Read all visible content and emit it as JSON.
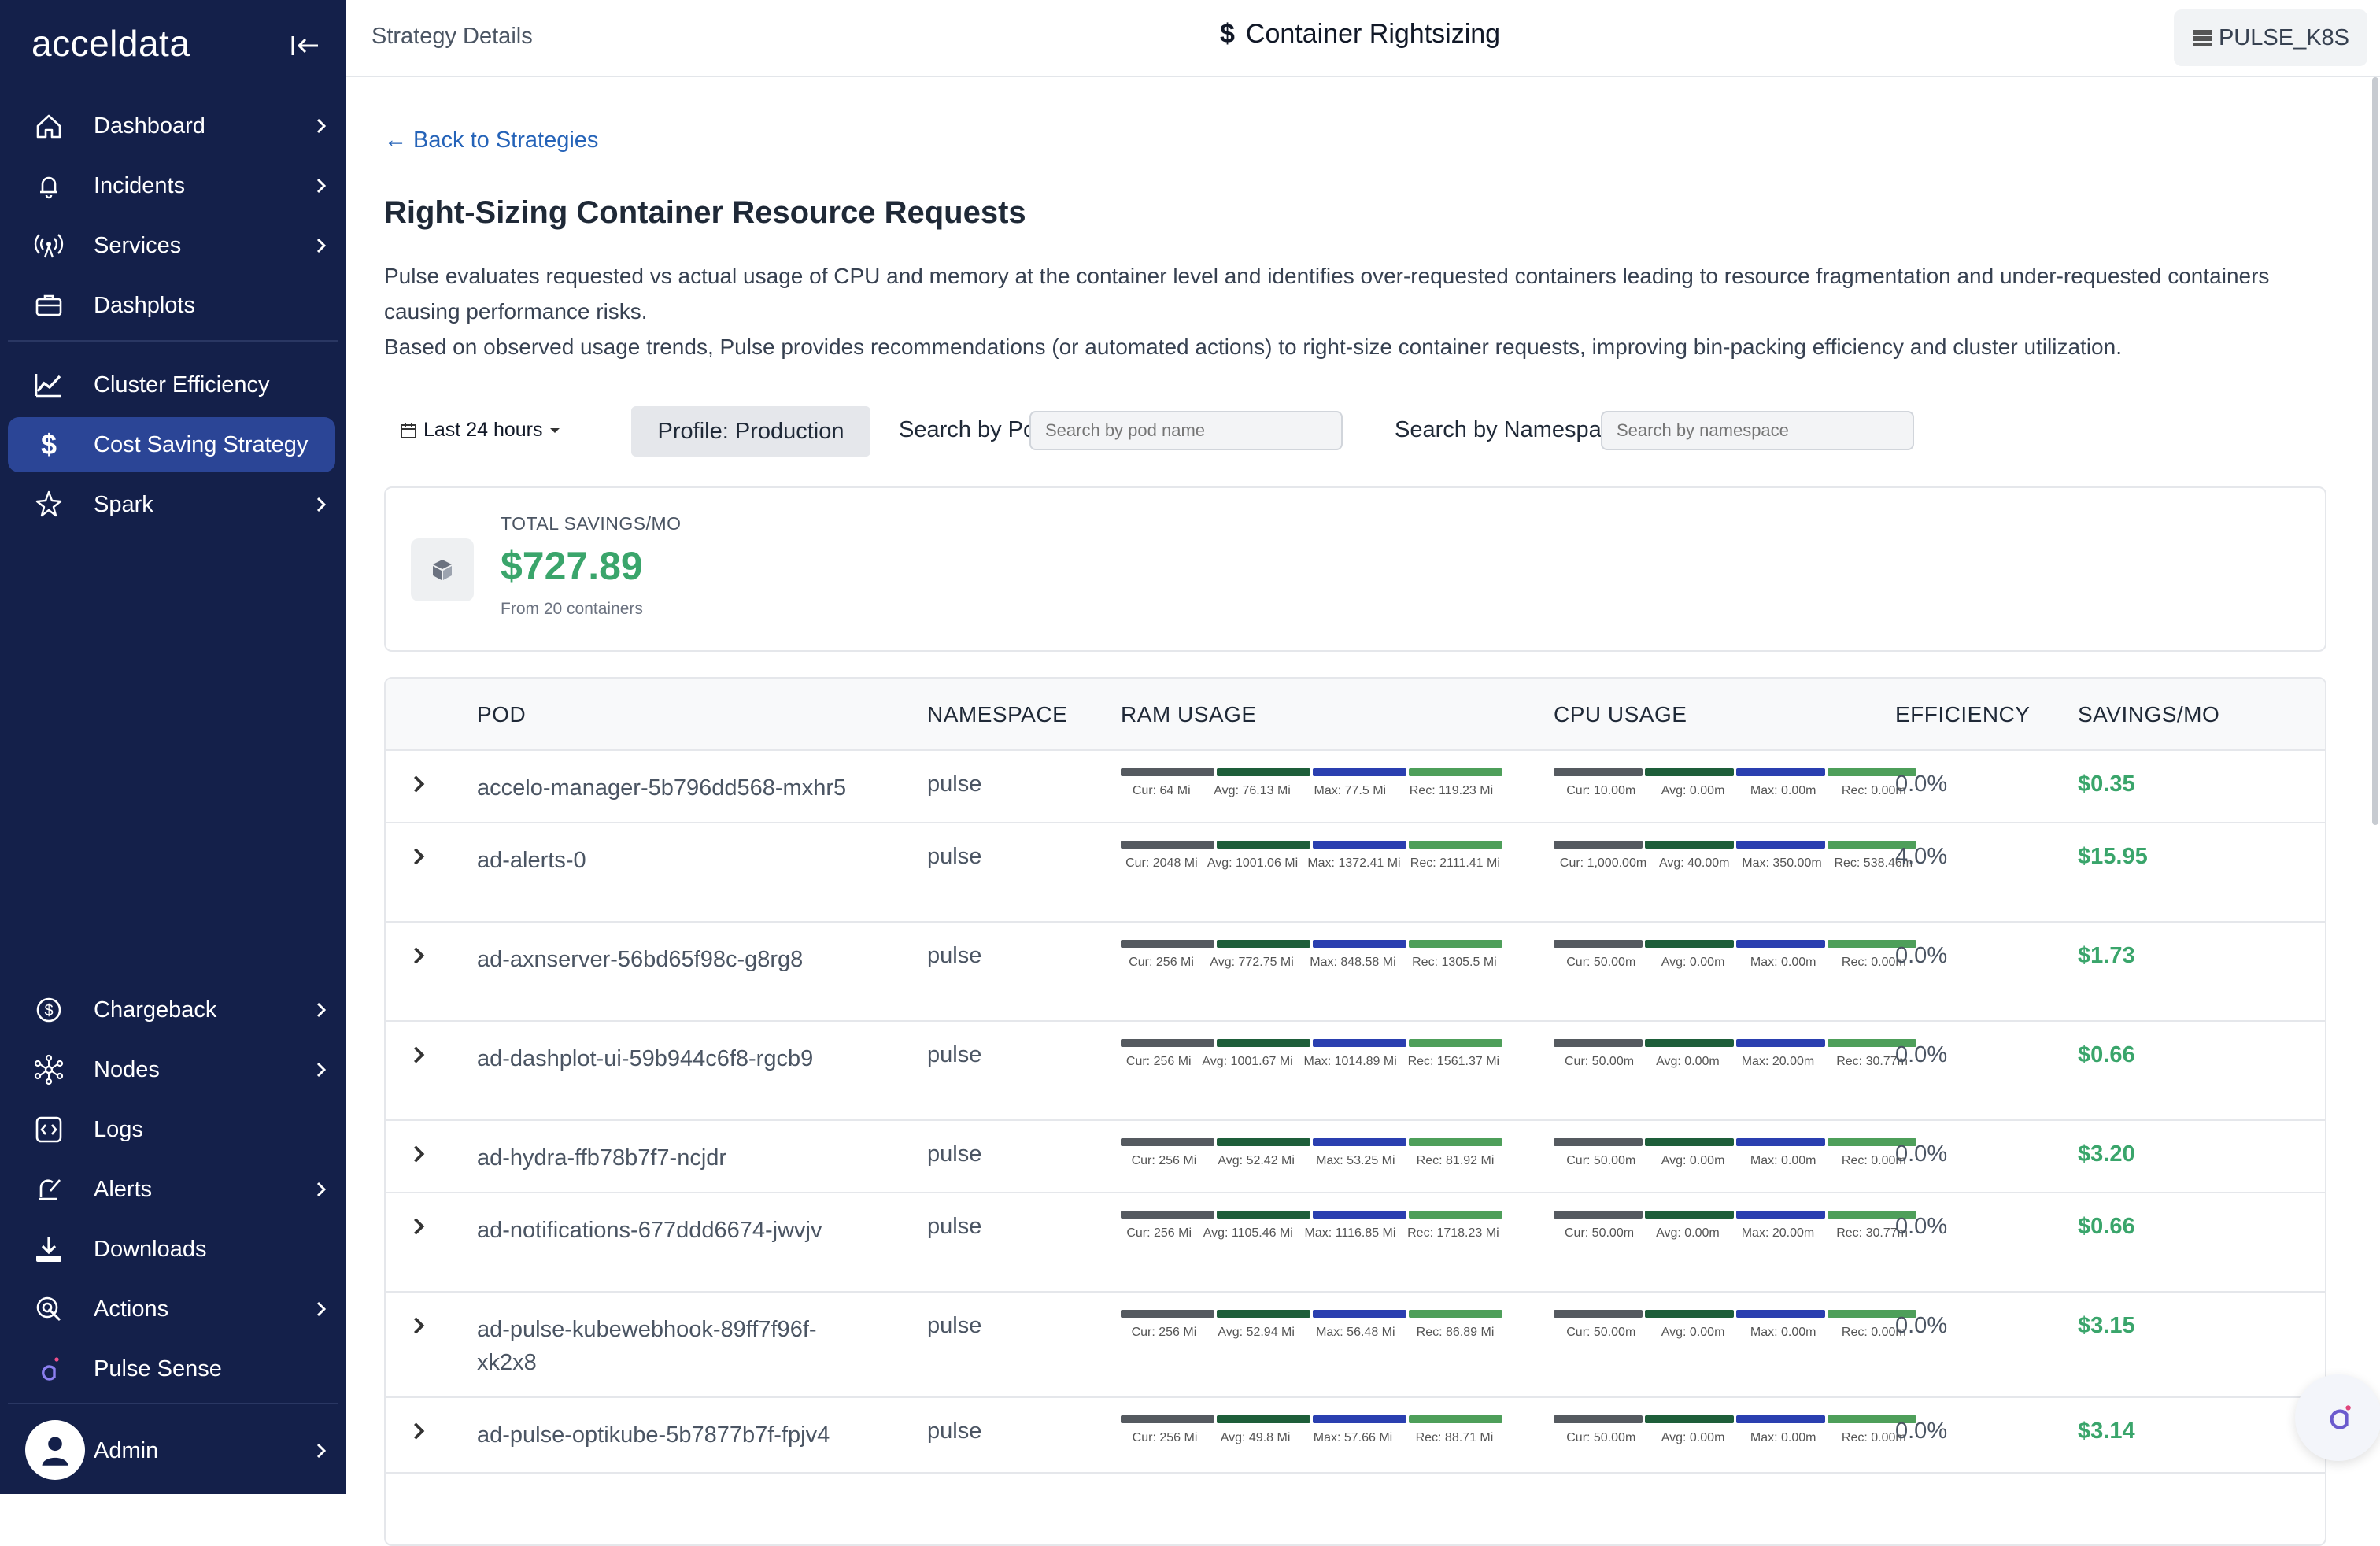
{
  "sidebar": {
    "logo": "acceldata",
    "items_top": [
      {
        "label": "Dashboard",
        "icon": "home-icon",
        "has_chevron": true
      },
      {
        "label": "Incidents",
        "icon": "bell-icon",
        "has_chevron": true
      },
      {
        "label": "Services",
        "icon": "broadcast-icon",
        "has_chevron": true
      },
      {
        "label": "Dashplots",
        "icon": "briefcase-icon",
        "has_chevron": false
      }
    ],
    "items_mid": [
      {
        "label": "Cluster Efficiency",
        "icon": "chart-line-icon",
        "has_chevron": false
      },
      {
        "label": "Cost Saving Strategy",
        "icon": "dollar-icon",
        "has_chevron": false,
        "active": true
      },
      {
        "label": "Spark",
        "icon": "spark-icon",
        "has_chevron": true
      }
    ],
    "items_bottom": [
      {
        "label": "Chargeback",
        "icon": "coin-icon",
        "has_chevron": true
      },
      {
        "label": "Nodes",
        "icon": "nodes-icon",
        "has_chevron": true
      },
      {
        "label": "Logs",
        "icon": "code-icon",
        "has_chevron": false
      },
      {
        "label": "Alerts",
        "icon": "alert-icon",
        "has_chevron": true
      },
      {
        "label": "Downloads",
        "icon": "download-icon",
        "has_chevron": false
      },
      {
        "label": "Actions",
        "icon": "actions-icon",
        "has_chevron": true
      },
      {
        "label": "Pulse Sense",
        "icon": "pulse-sense-icon",
        "has_chevron": false
      }
    ],
    "admin_label": "Admin"
  },
  "header": {
    "breadcrumb": "Strategy Details",
    "title": "Container Rightsizing",
    "cluster": "PULSE_K8S"
  },
  "main": {
    "back_link": "← Back to Strategies",
    "heading": "Right-Sizing Container Resource Requests",
    "desc1": "Pulse evaluates requested vs actual usage of CPU and memory at the container level and identifies over-requested containers leading to resource fragmentation and under-requested containers causing performance risks.",
    "desc2": "Based on observed usage trends, Pulse provides recommendations (or automated actions) to right-size container requests, improving bin-packing efficiency and cluster utilization."
  },
  "filters": {
    "date_range": "Last 24 hours",
    "profile": "Profile: Production",
    "pod_label": "Search by Pod:",
    "pod_placeholder": "Search by pod name",
    "ns_label": "Search by Namespace:",
    "ns_placeholder": "Search by namespace"
  },
  "summary": {
    "label": "TOTAL SAVINGS/MO",
    "value": "$727.89",
    "sub": "From 20 containers"
  },
  "table": {
    "columns": [
      "POD",
      "NAMESPACE",
      "RAM USAGE",
      "CPU USAGE",
      "EFFICIENCY",
      "SAVINGS/MO"
    ],
    "rows": [
      {
        "pod": "accelo-manager-5b796dd568-mxhr5",
        "namespace": "pulse",
        "ram": [
          "Cur: 64 Mi",
          "Avg: 76.13 Mi",
          "Max: 77.5 Mi",
          "Rec: 119.23 Mi"
        ],
        "cpu": [
          "Cur: 10.00m",
          "Avg: 0.00m",
          "Max: 0.00m",
          "Rec: 0.00m"
        ],
        "efficiency": "0.0%",
        "savings": "$0.35"
      },
      {
        "pod": "ad-alerts-0",
        "namespace": "pulse",
        "ram": [
          "Cur: 2048 Mi",
          "Avg: 1001.06 Mi",
          "Max: 1372.41 Mi",
          "Rec: 2111.41 Mi"
        ],
        "cpu": [
          "Cur: 1,000.00m",
          "Avg: 40.00m",
          "Max: 350.00m",
          "Rec: 538.46m"
        ],
        "efficiency": "4.0%",
        "savings": "$15.95"
      },
      {
        "pod": "ad-axnserver-56bd65f98c-g8rg8",
        "namespace": "pulse",
        "ram": [
          "Cur: 256 Mi",
          "Avg: 772.75 Mi",
          "Max: 848.58 Mi",
          "Rec: 1305.5 Mi"
        ],
        "cpu": [
          "Cur: 50.00m",
          "Avg: 0.00m",
          "Max: 0.00m",
          "Rec: 0.00m"
        ],
        "efficiency": "0.0%",
        "savings": "$1.73"
      },
      {
        "pod": "ad-dashplot-ui-59b944c6f8-rgcb9",
        "namespace": "pulse",
        "ram": [
          "Cur: 256 Mi",
          "Avg: 1001.67 Mi",
          "Max: 1014.89 Mi",
          "Rec: 1561.37 Mi"
        ],
        "cpu": [
          "Cur: 50.00m",
          "Avg: 0.00m",
          "Max: 20.00m",
          "Rec: 30.77m"
        ],
        "efficiency": "0.0%",
        "savings": "$0.66"
      },
      {
        "pod": "ad-hydra-ffb78b7f7-ncjdr",
        "namespace": "pulse",
        "ram": [
          "Cur: 256 Mi",
          "Avg: 52.42 Mi",
          "Max: 53.25 Mi",
          "Rec: 81.92 Mi"
        ],
        "cpu": [
          "Cur: 50.00m",
          "Avg: 0.00m",
          "Max: 0.00m",
          "Rec: 0.00m"
        ],
        "efficiency": "0.0%",
        "savings": "$3.20"
      },
      {
        "pod": "ad-notifications-677ddd6674-jwvjv",
        "namespace": "pulse",
        "ram": [
          "Cur: 256 Mi",
          "Avg: 1105.46 Mi",
          "Max: 1116.85 Mi",
          "Rec: 1718.23 Mi"
        ],
        "cpu": [
          "Cur: 50.00m",
          "Avg: 0.00m",
          "Max: 20.00m",
          "Rec: 30.77m"
        ],
        "efficiency": "0.0%",
        "savings": "$0.66"
      },
      {
        "pod": "ad-pulse-kubewebhook-89ff7f96f-xk2x8",
        "namespace": "pulse",
        "ram": [
          "Cur: 256 Mi",
          "Avg: 52.94 Mi",
          "Max: 56.48 Mi",
          "Rec: 86.89 Mi"
        ],
        "cpu": [
          "Cur: 50.00m",
          "Avg: 0.00m",
          "Max: 0.00m",
          "Rec: 0.00m"
        ],
        "efficiency": "0.0%",
        "savings": "$3.15"
      },
      {
        "pod": "ad-pulse-optikube-5b7877b7f-fpjv4",
        "namespace": "pulse",
        "ram": [
          "Cur: 256 Mi",
          "Avg: 49.8 Mi",
          "Max: 57.66 Mi",
          "Rec: 88.71 Mi"
        ],
        "cpu": [
          "Cur: 50.00m",
          "Avg: 0.00m",
          "Max: 0.00m",
          "Rec: 0.00m"
        ],
        "efficiency": "0.0%",
        "savings": "$3.14"
      }
    ]
  }
}
